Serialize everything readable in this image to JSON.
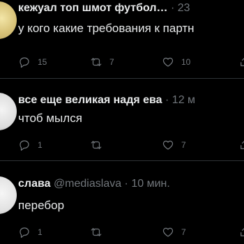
{
  "tweets": [
    {
      "name": "кежуал топ шмот футбол…",
      "meta": "· 23",
      "text": "у кого какие требования к партн",
      "replies": "15",
      "retweets": "7",
      "likes": "10"
    },
    {
      "name": "все еще великая надя ева",
      "meta": "· 12 м",
      "text": "чтоб мылся",
      "replies": "1",
      "retweets": "",
      "likes": "7"
    },
    {
      "name": "слава",
      "meta": "@mediaslava · 10 мин.",
      "text": "перебор",
      "replies": "1",
      "retweets": "",
      "likes": "7"
    }
  ],
  "colors": {
    "background": "#000000",
    "text": "#e7e9ea",
    "muted": "#71767b",
    "divider": "#2f3336"
  }
}
